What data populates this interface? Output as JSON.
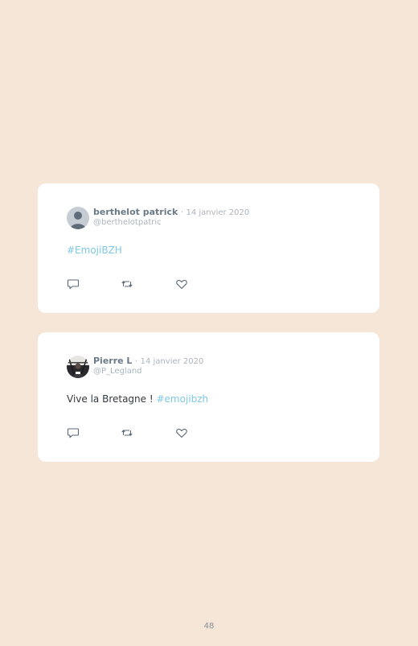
{
  "tweets": [
    {
      "name": "berthelot patrick",
      "separator": "·",
      "date": "14 janvier 2020",
      "handle": "@berthelotpatric",
      "text": "",
      "hashtag": "#EmojiBZH"
    },
    {
      "name": "Pierre L",
      "separator": "·",
      "date": "14 janvier 2020",
      "handle": "@P_Legland",
      "text": "Vive la Bretagne ! ",
      "hashtag": "#emojibzh"
    }
  ],
  "icons": {
    "reply": "reply-icon",
    "retweet": "retweet-icon",
    "like": "heart-icon"
  },
  "colors": {
    "background": "#f5e6d8",
    "card": "#ffffff",
    "hashtag": "#7fc8e6",
    "name": "#6b7a89",
    "muted": "#aab4bf",
    "icon": "#5a6775"
  },
  "page_number": "48"
}
